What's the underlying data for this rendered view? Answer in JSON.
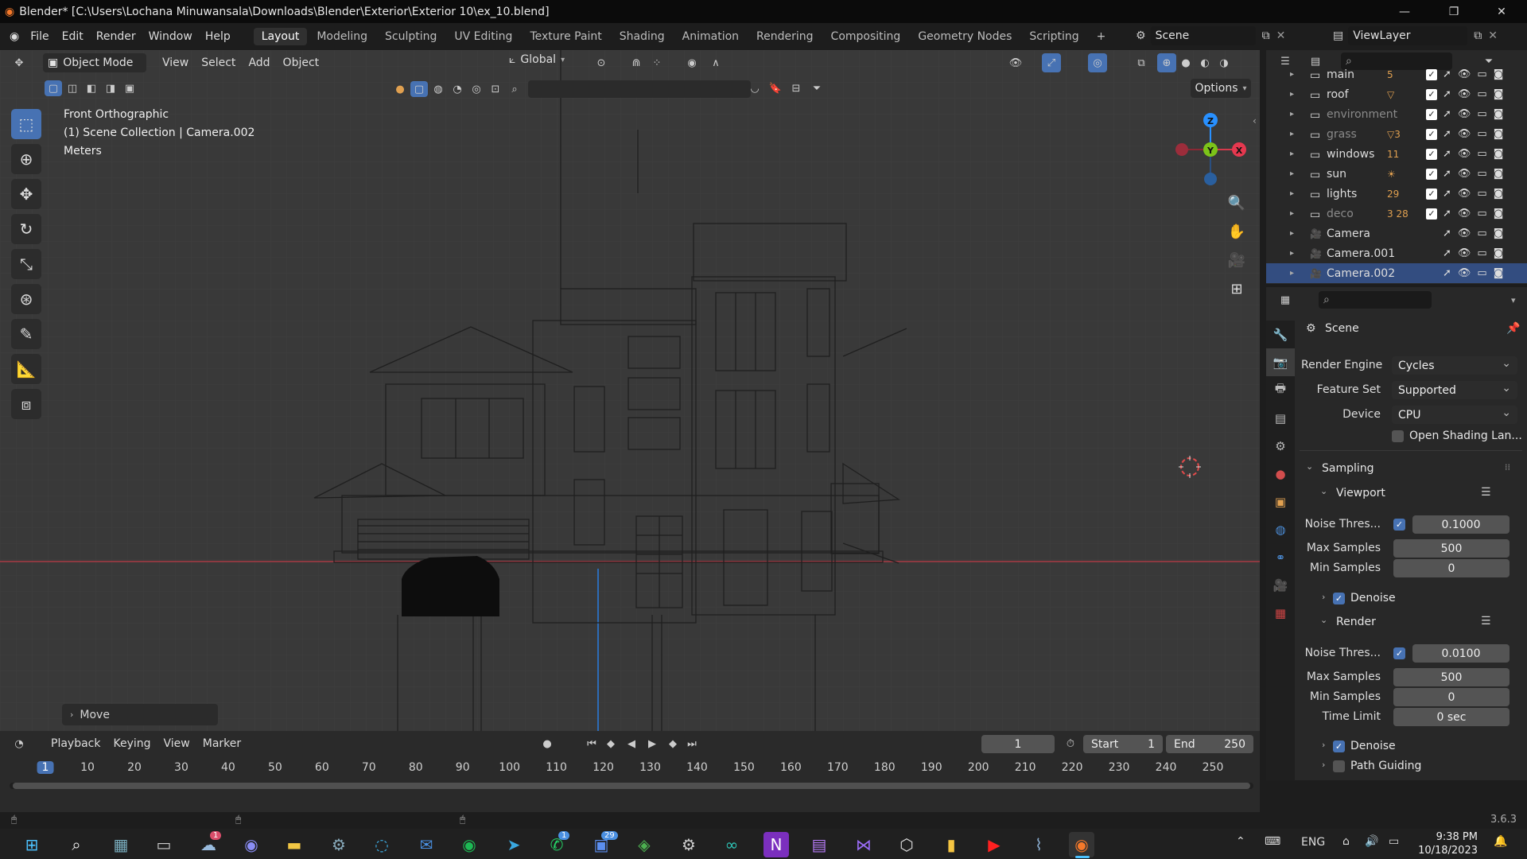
{
  "window": {
    "title": "Blender* [C:\\Users\\Lochana Minuwansala\\Downloads\\Blender\\Exterior\\Exterior 10\\ex_10.blend]",
    "minimize": "—",
    "maximize": "❐",
    "close": "✕"
  },
  "menubar": {
    "menus": [
      "File",
      "Edit",
      "Render",
      "Window",
      "Help"
    ],
    "workspaces": [
      "Layout",
      "Modeling",
      "Sculpting",
      "UV Editing",
      "Texture Paint",
      "Shading",
      "Animation",
      "Rendering",
      "Compositing",
      "Geometry Nodes",
      "Scripting"
    ],
    "active_workspace": "Layout",
    "add_workspace": "+",
    "scene": "Scene",
    "view_layer": "ViewLayer"
  },
  "viewport": {
    "mode": "Object Mode",
    "menus": [
      "View",
      "Select",
      "Add",
      "Object"
    ],
    "orientation": "Global",
    "options": "Options",
    "overlay_lines": [
      "Front Orthographic",
      "(1) Scene Collection | Camera.002",
      "Meters"
    ],
    "last_operator": "Move",
    "gizmo_axes": {
      "z": "Z",
      "y": "Y",
      "x": "X"
    },
    "colors": {
      "x_axis": "#ff3352",
      "y_axis": "#8bdc00",
      "z_axis": "#2890ff",
      "bg": "#393939"
    }
  },
  "outliner": {
    "items": [
      {
        "name": "main",
        "badge": "5",
        "dim": false,
        "type": "collection",
        "selected": false
      },
      {
        "name": "roof",
        "badge": "▽",
        "dim": false,
        "type": "collection",
        "selected": false
      },
      {
        "name": "environment",
        "badge": "",
        "dim": true,
        "type": "collection",
        "selected": false
      },
      {
        "name": "grass",
        "badge": "▽3",
        "dim": true,
        "type": "collection",
        "selected": false
      },
      {
        "name": "windows",
        "badge": "11",
        "dim": false,
        "type": "collection",
        "selected": false
      },
      {
        "name": "sun",
        "badge": "☀",
        "dim": false,
        "type": "collection",
        "selected": false
      },
      {
        "name": "lights",
        "badge": "29",
        "dim": false,
        "type": "collection",
        "selected": false
      },
      {
        "name": "deco",
        "badge": "3 28",
        "dim": true,
        "type": "collection",
        "selected": false
      },
      {
        "name": "Camera",
        "badge": "",
        "dim": false,
        "type": "camera",
        "selected": false
      },
      {
        "name": "Camera.001",
        "badge": "",
        "dim": false,
        "type": "camera",
        "selected": false
      },
      {
        "name": "Camera.002",
        "badge": "",
        "dim": false,
        "type": "camera",
        "selected": true
      }
    ]
  },
  "properties": {
    "context": "Scene",
    "render_engine_label": "Render Engine",
    "render_engine": "Cycles",
    "feature_set_label": "Feature Set",
    "feature_set": "Supported",
    "device_label": "Device",
    "device": "CPU",
    "osl_label": "Open Shading Lan...",
    "sampling": "Sampling",
    "viewport": {
      "title": "Viewport",
      "noise_label": "Noise Thres...",
      "noise": "0.1000",
      "max_label": "Max Samples",
      "max": "500",
      "min_label": "Min Samples",
      "min": "0",
      "denoise": "Denoise"
    },
    "render": {
      "title": "Render",
      "noise_label": "Noise Thres...",
      "noise": "0.0100",
      "max_label": "Max Samples",
      "max": "500",
      "min_label": "Min Samples",
      "min": "0",
      "time_label": "Time Limit",
      "time": "0 sec",
      "denoise": "Denoise",
      "path_guiding": "Path Guiding"
    }
  },
  "timeline": {
    "menus": [
      "Playback",
      "Keying",
      "View",
      "Marker"
    ],
    "current_frame": "1",
    "start_label": "Start",
    "start": "1",
    "end_label": "End",
    "end": "250",
    "ruler_ticks": [
      "1",
      "10",
      "20",
      "30",
      "40",
      "50",
      "60",
      "70",
      "80",
      "90",
      "100",
      "110",
      "120",
      "130",
      "140",
      "150",
      "160",
      "170",
      "180",
      "190",
      "200",
      "210",
      "220",
      "230",
      "240",
      "250"
    ]
  },
  "statusbar": {
    "version": "3.6.3"
  },
  "taskbar": {
    "lang": "ENG",
    "time": "9:38 PM",
    "date": "10/18/2023",
    "badges": {
      "weather": "1",
      "whatsapp": "1",
      "teams": "29"
    }
  }
}
